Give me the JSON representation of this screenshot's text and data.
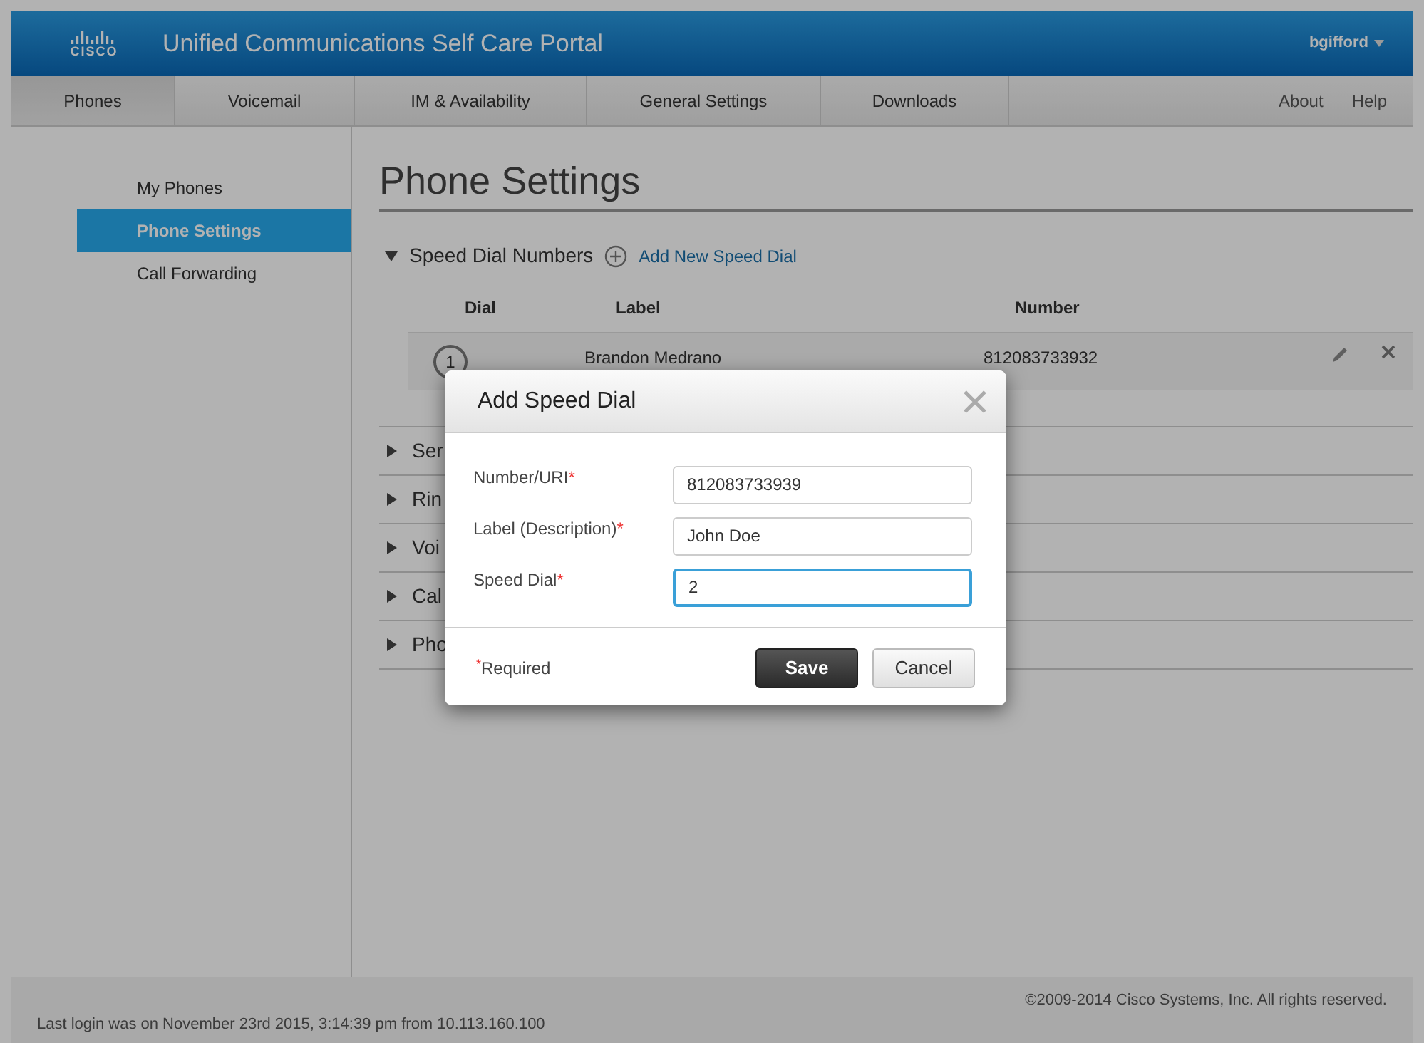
{
  "header": {
    "logo_text": "CISCO",
    "title": "Unified Communications Self Care Portal",
    "user": "bgifford"
  },
  "tabs": [
    {
      "label": "Phones",
      "selected": true
    },
    {
      "label": "Voicemail",
      "selected": false
    },
    {
      "label": "IM & Availability",
      "selected": false
    },
    {
      "label": "General Settings",
      "selected": false
    },
    {
      "label": "Downloads",
      "selected": false
    }
  ],
  "utility_links": [
    "About",
    "Help"
  ],
  "sidebar": {
    "items": [
      {
        "label": "My Phones",
        "selected": false
      },
      {
        "label": "Phone Settings",
        "selected": true
      },
      {
        "label": "Call Forwarding",
        "selected": false
      }
    ]
  },
  "page_title": "Phone Settings",
  "speed_dial": {
    "title": "Speed Dial Numbers",
    "expanded": true,
    "add_link": "Add New Speed Dial",
    "columns": [
      "Dial",
      "Label",
      "Number"
    ],
    "rows": [
      {
        "dial": "1",
        "label": "Brandon Medrano",
        "number": "812083733932"
      }
    ]
  },
  "other_sections": [
    {
      "label": "Ser",
      "expanded": false
    },
    {
      "label": "Rin",
      "expanded": false
    },
    {
      "label": "Voi",
      "expanded": false
    },
    {
      "label": "Cal",
      "expanded": false
    },
    {
      "label": "Pho",
      "expanded": false
    }
  ],
  "dialog": {
    "title": "Add Speed Dial",
    "fields": [
      {
        "label": "Number/URI",
        "marker": "*",
        "value": "812083733939",
        "focused": false
      },
      {
        "label": "Label (Description)",
        "marker": "*",
        "value": "John Doe",
        "focused": false
      },
      {
        "label": "Speed Dial",
        "marker": "*",
        "value": "2",
        "focused": true
      }
    ],
    "required_marker": "*",
    "required_note": "Required",
    "buttons": [
      {
        "label": "Save",
        "kind": "primary"
      },
      {
        "label": "Cancel",
        "kind": "secondary"
      }
    ]
  },
  "footer": {
    "copyright": "©2009-2014 Cisco Systems, Inc. All rights reserved.",
    "last_login": "Last login was on November 23rd 2015, 3:14:39 pm from 10.113.160.100"
  }
}
